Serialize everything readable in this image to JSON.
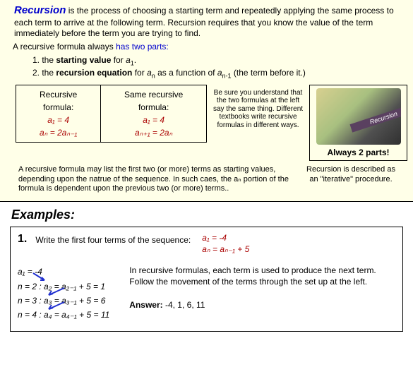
{
  "intro": {
    "keyword": "Recursion",
    "rest": " is the process of choosing a starting term and repeatedly applying the same process to each term to arrive at the following term.  Recursion requires that you know the value of the term immediately before the term you are trying to find."
  },
  "parts": {
    "lead": "A recursive formula always ",
    "link": "has two parts:",
    "p1_a": "1.  the ",
    "p1_b": "starting value",
    "p1_c": " for ",
    "p1_var": "a",
    "p1_sub": "1",
    "p2_a": "2.  the ",
    "p2_b": "recursion equation",
    "p2_c": " for ",
    "p2_var": "a",
    "p2_sub": "n",
    "p2_d": " as a function of ",
    "p2_var2": "a",
    "p2_sub2": "n-1",
    "p2_e": " (the term before it.)"
  },
  "table": {
    "h1": "Recursive formula:",
    "h2": "Same recursive formula:",
    "c1a": "a₁ = 4",
    "c1b": "aₙ = 2aₙ₋₁",
    "c2a": "a₁ = 4",
    "c2b": "aₙ₊₁ = 2aₙ"
  },
  "note": "Be sure you understand that the two formulas at the left say the same thing.  Different textbooks write recursive formulas in different ways.",
  "right": {
    "banner": "Recursion",
    "caption": "Always 2 parts!"
  },
  "post": {
    "left": "A recursive formula may list the first two (or more) terms as starting values, depending upon the natrue of the sequence. In such caes, the aₙ portion of the formula is dependent upon the previous two (or more) terms..",
    "right": "Recursion is described as an \"iterative\" procedure."
  },
  "examplesHeader": "Examples:",
  "ex1": {
    "num": "1.",
    "q": "Write the first four terms of the sequence:",
    "eq1": "a₁ = -4",
    "eq2": "aₙ = aₙ₋₁ + 5",
    "w1": "a₁ = -4",
    "w2": "n = 2 :  a₂ = a₂₋₁ + 5 = 1",
    "w3": "n = 3 :  a₃ = a₃₋₁ + 5 = 6",
    "w4": "n = 4 :  a₄ = a₄₋₁ + 5 = 11",
    "explain": "In recursive formulas, each term is used to produce the next term.  Follow the movement of the terms through the set up at the left.",
    "ansLabel": "Answer:",
    "ansVal": "  -4, 1, 6, 11"
  }
}
